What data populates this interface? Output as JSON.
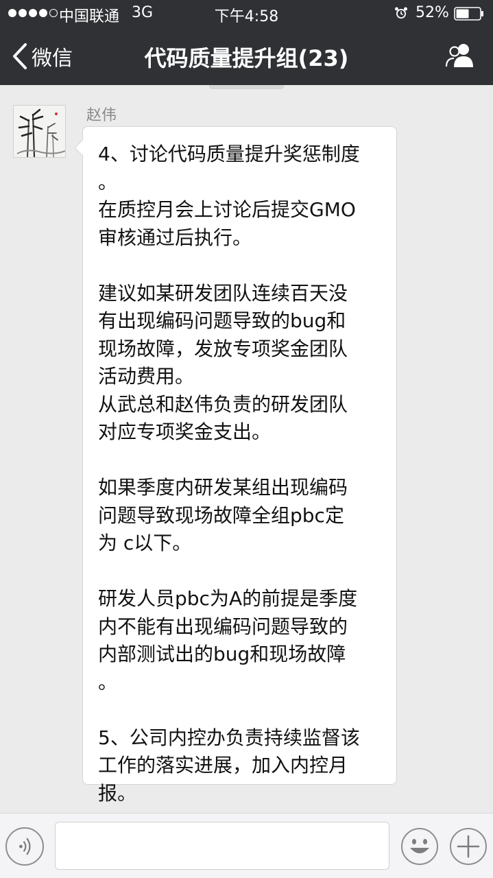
{
  "status_bar": {
    "carrier": "中国联通",
    "network": "3G",
    "time": "下午4:58",
    "battery": "52%",
    "alarm_icon": "alarm-clock-icon",
    "battery_icon": "battery-icon",
    "signal_icon": "signal-dots-icon"
  },
  "nav": {
    "back_label": "微信",
    "title": "代码质量提升组(23)",
    "back_icon": "chevron-left-icon",
    "contacts_icon": "group-members-icon"
  },
  "chat": {
    "sender_name": "赵伟",
    "avatar_icon": "bamboo-painting-avatar",
    "message_lines": [
      "4、讨论代码质量提升奖惩制度",
      "。",
      "在质控月会上讨论后提交GMO",
      "审核通过后执行。",
      "",
      "建议如某研发团队连续百天没",
      "有出现编码问题导致的bug和",
      "现场故障，发放专项奖金团队",
      "活动费用。",
      "从武总和赵伟负责的研发团队",
      "对应专项奖金支出。",
      "",
      "如果季度内研发某组出现编码",
      "问题导致现场故障全组pbc定",
      "为 c以下。",
      "",
      "研发人员pbc为A的前提是季度",
      "内不能有出现编码问题导致的",
      "内部测试出的bug和现场故障",
      "。",
      "",
      "5、公司内控办负责持续监督该",
      "工作的落实进展，加入内控月",
      "报。"
    ]
  },
  "input_bar": {
    "voice_icon": "voice-mode-icon",
    "text_value": "",
    "emoji_icon": "emoji-smile-icon",
    "plus_icon": "plus-icon"
  },
  "colors": {
    "header_bg": "#2f3135",
    "chat_bg": "#ebebeb",
    "bubble_bg": "#ffffff",
    "sender_name": "#8a8a8a"
  }
}
